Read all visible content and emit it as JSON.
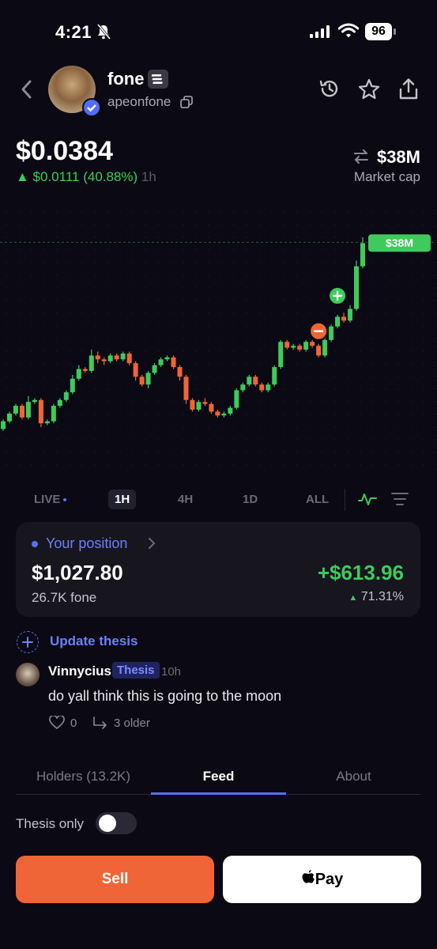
{
  "status_bar": {
    "time": "4:21",
    "battery": "96"
  },
  "header": {
    "coin_name": "fone",
    "handle": "apeonfone",
    "icons": [
      "back-icon",
      "history-icon",
      "star-icon",
      "share-icon",
      "copy-icon"
    ]
  },
  "price": {
    "value": "$0.0384",
    "change": "▲ $0.0111 (40.88%)",
    "change_period": "1h",
    "market_cap_value": "$38M",
    "market_cap_label": "Market cap",
    "up_color": "#3ecb5b",
    "down_color": "#f06537"
  },
  "chart_data": {
    "type": "candlestick",
    "title": "",
    "current_label": "$38M",
    "candles": [
      [
        1,
        5,
        6,
        0
      ],
      [
        5,
        9,
        10,
        4
      ],
      [
        9,
        13,
        14,
        8
      ],
      [
        13,
        7,
        14,
        6
      ],
      [
        7,
        15,
        18,
        6
      ],
      [
        15,
        16,
        17,
        14
      ],
      [
        16,
        4,
        17,
        2
      ],
      [
        4,
        5,
        6,
        3
      ],
      [
        5,
        13,
        14,
        4
      ],
      [
        13,
        16,
        17,
        12
      ],
      [
        16,
        20,
        21,
        15
      ],
      [
        20,
        27,
        29,
        19
      ],
      [
        27,
        32,
        34,
        26
      ],
      [
        32,
        31,
        33,
        30
      ],
      [
        31,
        39,
        42,
        30
      ],
      [
        39,
        37,
        41,
        35
      ],
      [
        37,
        36,
        38,
        34
      ],
      [
        36,
        39,
        40,
        35
      ],
      [
        39,
        37,
        40,
        36
      ],
      [
        37,
        40,
        41,
        36
      ],
      [
        40,
        35,
        41,
        34
      ],
      [
        35,
        28,
        36,
        26
      ],
      [
        28,
        24,
        29,
        23
      ],
      [
        24,
        30,
        31,
        22
      ],
      [
        30,
        34,
        35,
        29
      ],
      [
        34,
        37,
        38,
        33
      ],
      [
        37,
        38,
        39,
        36
      ],
      [
        38,
        33,
        39,
        32
      ],
      [
        33,
        28,
        34,
        26
      ],
      [
        28,
        16,
        29,
        14
      ],
      [
        16,
        11,
        17,
        10
      ],
      [
        11,
        15,
        16,
        10
      ],
      [
        15,
        14,
        17,
        13
      ],
      [
        14,
        10,
        15,
        9
      ],
      [
        10,
        8,
        11,
        7
      ],
      [
        8,
        9,
        10,
        7
      ],
      [
        9,
        12,
        13,
        8
      ],
      [
        12,
        21,
        22,
        11
      ],
      [
        21,
        24,
        25,
        20
      ],
      [
        24,
        28,
        29,
        23
      ],
      [
        28,
        24,
        29,
        23
      ],
      [
        24,
        21,
        25,
        20
      ],
      [
        21,
        24,
        25,
        20
      ],
      [
        24,
        33,
        34,
        23
      ],
      [
        33,
        46,
        47,
        32
      ],
      [
        46,
        43,
        47,
        42
      ],
      [
        43,
        44,
        45,
        42
      ],
      [
        44,
        42,
        45,
        41
      ],
      [
        42,
        46,
        47,
        41
      ],
      [
        46,
        44,
        47,
        43
      ],
      [
        44,
        39,
        45,
        38
      ],
      [
        39,
        47,
        48,
        38
      ],
      [
        47,
        54,
        55,
        46
      ],
      [
        54,
        59,
        60,
        53
      ],
      [
        59,
        57,
        61,
        56
      ],
      [
        57,
        63,
        65,
        56
      ],
      [
        63,
        85,
        88,
        62
      ],
      [
        85,
        97,
        100,
        84
      ]
    ],
    "markers": [
      {
        "type": "sell",
        "candle_index": 50
      },
      {
        "type": "buy",
        "candle_index": 53
      }
    ]
  },
  "timeframes": {
    "items": [
      "LIVE",
      "1H",
      "4H",
      "1D",
      "ALL"
    ],
    "active": "1H"
  },
  "position": {
    "label": "Your position",
    "value": "$1,027.80",
    "quantity": "26.7K fone",
    "pnl": "+$613.96",
    "pnl_pct": "71.31%"
  },
  "thesis": {
    "update_label": "Update thesis",
    "comment": {
      "user": "Vinnycius",
      "tag": "Thesis",
      "time": "10h",
      "text": "do yall think this is going to the moon",
      "likes": "0",
      "older": "3 older"
    }
  },
  "tabs": {
    "items": [
      "Holders (13.2K)",
      "Feed",
      "About"
    ],
    "active": "Feed"
  },
  "filter": {
    "thesis_only_label": "Thesis only",
    "thesis_only_on": false
  },
  "actions": {
    "sell": "Sell",
    "pay": "Pay"
  }
}
